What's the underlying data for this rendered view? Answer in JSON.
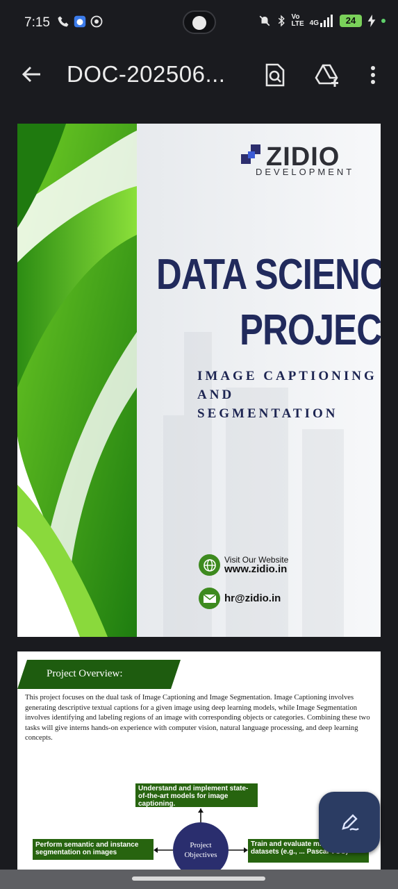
{
  "status_bar": {
    "time": "7:15",
    "network_label_top": "Vo",
    "network_label_bottom": "LTE",
    "signal_label": "4G",
    "battery": "24"
  },
  "toolbar": {
    "back_icon": "arrow-left-icon",
    "title": "DOC-202506...",
    "search_icon": "document-search-icon",
    "drive_icon": "add-to-drive-icon",
    "menu_icon": "more-vert-icon"
  },
  "cover": {
    "brand_name": "ZIDIO",
    "brand_sub": "DEVELOPMENT",
    "title_line1": "DATA SCIENCE",
    "title_line2": "PROJECT",
    "subtitle_line1": "IMAGE CAPTIONING",
    "subtitle_line2": "AND",
    "subtitle_line3": "SEGMENTATION",
    "visit_label": "Visit Our Website",
    "website": "www.zidio.in",
    "email": "hr@zidio.in",
    "accent_green": "#3d8a1f",
    "title_color": "#212a5c"
  },
  "overview": {
    "heading": "Project Overview:",
    "paragraph": "This project focuses on the dual task of Image Captioning and Image Segmentation. Image Captioning involves generating descriptive textual captions for a given image using deep learning models, while Image Segmentation involves identifying and labeling regions of an image with corresponding objects or categories. Combining these two tasks will give interns hands-on experience with computer vision, natural language processing, and deep learning concepts.",
    "objective_top": "Understand and implement state-of-the-art models for image captioning.",
    "objective_left": "Perform semantic and instance segmentation on images",
    "objective_right": "Train and evaluate m... standard datasets (e.g., ... Pascal VOC)",
    "center_label": "Project Objectives"
  },
  "fab": {
    "icon": "edit-pen-icon"
  }
}
